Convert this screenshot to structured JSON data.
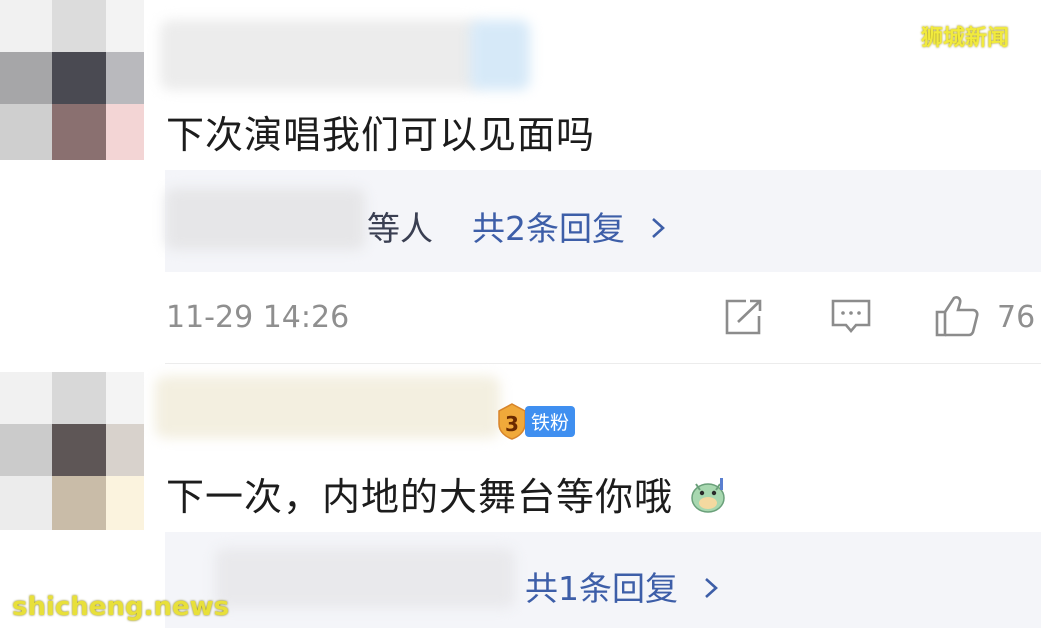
{
  "watermark_top": "狮城新闻",
  "watermark_bottom": "shicheng.news",
  "comments": [
    {
      "text": "下次演唱我们可以见面吗",
      "reply_prefix": "等人",
      "reply_link": "共2条回复",
      "time": "11-29 14:26",
      "likes": "76"
    },
    {
      "badge_level": "3",
      "badge_label": "铁粉",
      "text": "下一次，内地的大舞台等你哦",
      "reply_link": "共1条回复"
    }
  ],
  "icons": [
    "share-icon",
    "comment-icon",
    "like-icon",
    "chevron-right-icon",
    "emoji-sticker-icon",
    "fan-level-icon"
  ]
}
